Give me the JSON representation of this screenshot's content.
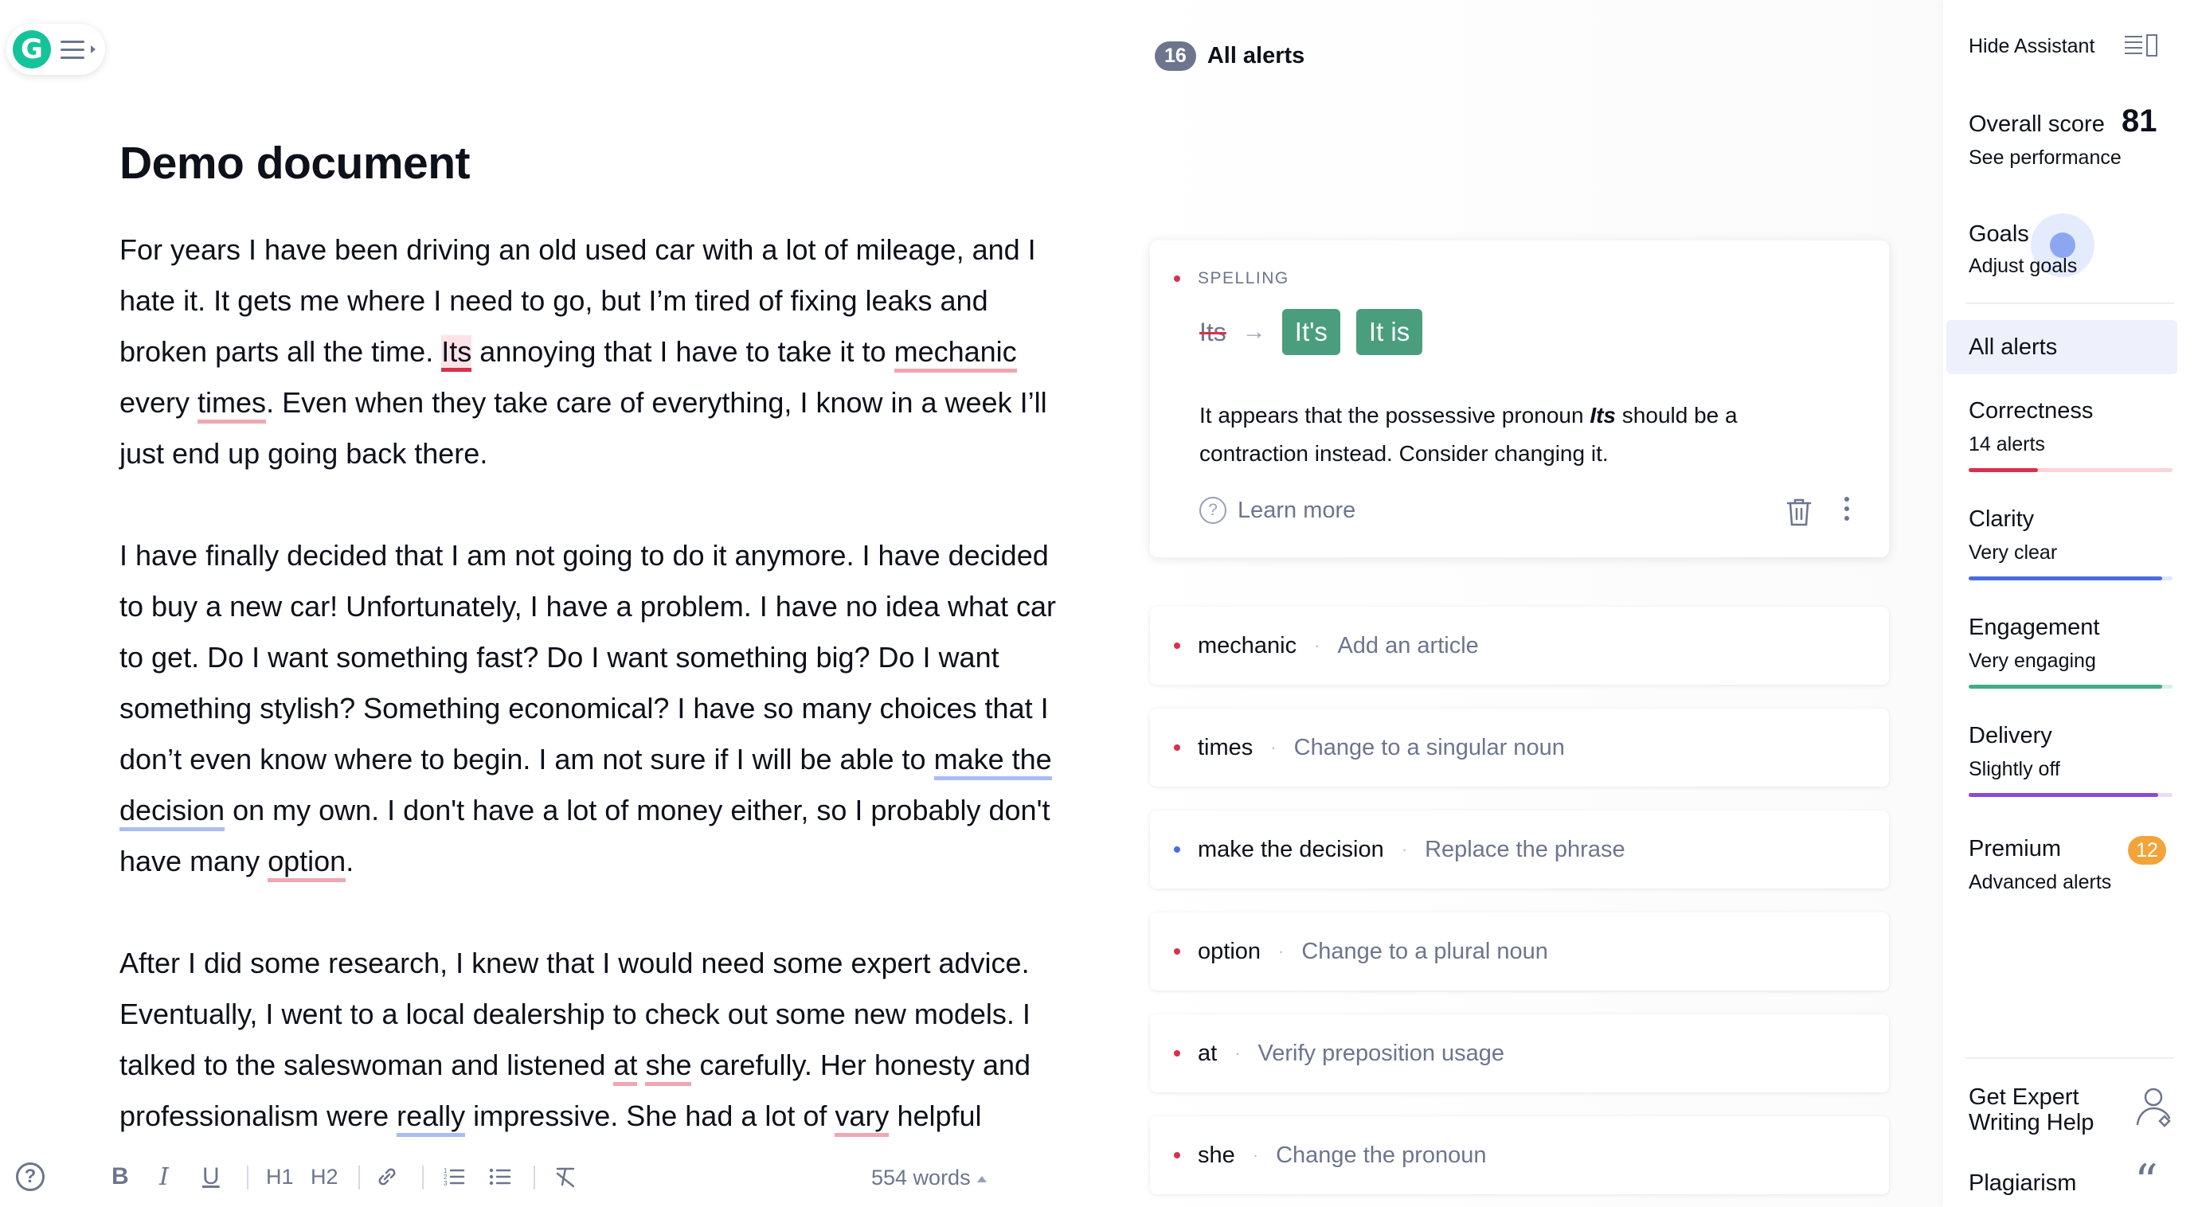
{
  "editor": {
    "title": "Demo document",
    "para1": {
      "t1": "For years I have been driving an old used car with a lot of mileage, and I hate it. It gets me where I need to go, but I’m tired of fixing leaks and broken parts all the time. ",
      "e1": "Its",
      "t2": " annoying that I have to take it to ",
      "e2": "mechanic",
      "t3": " every ",
      "e3": "times",
      "t4": ". Even when they take care of everything, I know in a week I’ll just end up going back there."
    },
    "para2": {
      "t1": "I have finally decided that I am not going to do it anymore. I have decided to buy a new car! Unfortunately, I have a problem. I have no idea what car to get. Do I want something fast? Do I want something big? Do I want something stylish? Something economical? I have so many choices that I don’t even know where to begin. I am not sure if I will be able to ",
      "c1": "make the decision",
      "t2": " on my own. I don't have a lot of money either, so I probably don't have many ",
      "e1": "option",
      "t3": "."
    },
    "para3": {
      "t1": "After I did some research, I knew that I would need some expert advice. Eventually, I went to a local dealership to check out some new models. I talked to the saleswoman and listened ",
      "e1": "at",
      "t2": " ",
      "e2": "she",
      "t3": " carefully. Her honesty and professionalism were ",
      "c1": "really",
      "t4": " impressive. She had a lot of ",
      "e3": "vary",
      "t5": " helpful"
    },
    "toolbar": {
      "bold": "B",
      "italic": "I",
      "underline": "U",
      "h1": "H1",
      "h2": "H2",
      "word_count": "554 words"
    }
  },
  "alerts": {
    "count": "16",
    "title": "All alerts",
    "active": {
      "category": "SPELLING",
      "original": "Its",
      "suggestions": [
        "It's",
        "It is"
      ],
      "explain_pre": "It appears that the possessive pronoun ",
      "explain_word": "Its",
      "explain_post": " should be a contraction instead. Consider changing it.",
      "learn_more": "Learn more"
    },
    "items": [
      {
        "word": "mechanic",
        "desc": "Add an article",
        "color": "#d9304c"
      },
      {
        "word": "times",
        "desc": "Change to a singular noun",
        "color": "#d9304c"
      },
      {
        "word": "make the decision",
        "desc": "Replace the phrase",
        "color": "#4a6ee0"
      },
      {
        "word": "option",
        "desc": "Change to a plural noun",
        "color": "#d9304c"
      },
      {
        "word": "at",
        "desc": "Verify preposition usage",
        "color": "#d9304c"
      },
      {
        "word": "she",
        "desc": "Change the pronoun",
        "color": "#d9304c"
      }
    ],
    "separator": "·"
  },
  "sidebar": {
    "hide_assistant": "Hide Assistant",
    "score_label": "Overall score",
    "score": "81",
    "see_performance": "See performance",
    "goals": "Goals",
    "adjust_goals": "Adjust goals",
    "all_alerts": "All alerts",
    "categories": [
      {
        "name": "Correctness",
        "sub": "14 alerts",
        "color": "#d9304c",
        "bg": "#fad4da",
        "fill": 0.34
      },
      {
        "name": "Clarity",
        "sub": "Very clear",
        "color": "#4a6ee0",
        "bg": "#dfe6fb",
        "fill": 0.95
      },
      {
        "name": "Engagement",
        "sub": "Very engaging",
        "color": "#3fae85",
        "bg": "#d7efe6",
        "fill": 0.95
      },
      {
        "name": "Delivery",
        "sub": "Slightly off",
        "color": "#8a4bd6",
        "bg": "#e9dcf8",
        "fill": 0.93
      }
    ],
    "premium": "Premium",
    "premium_sub": "Advanced alerts",
    "premium_count": "12",
    "expert_help": "Get Expert Writing Help",
    "plagiarism": "Plagiarism"
  }
}
